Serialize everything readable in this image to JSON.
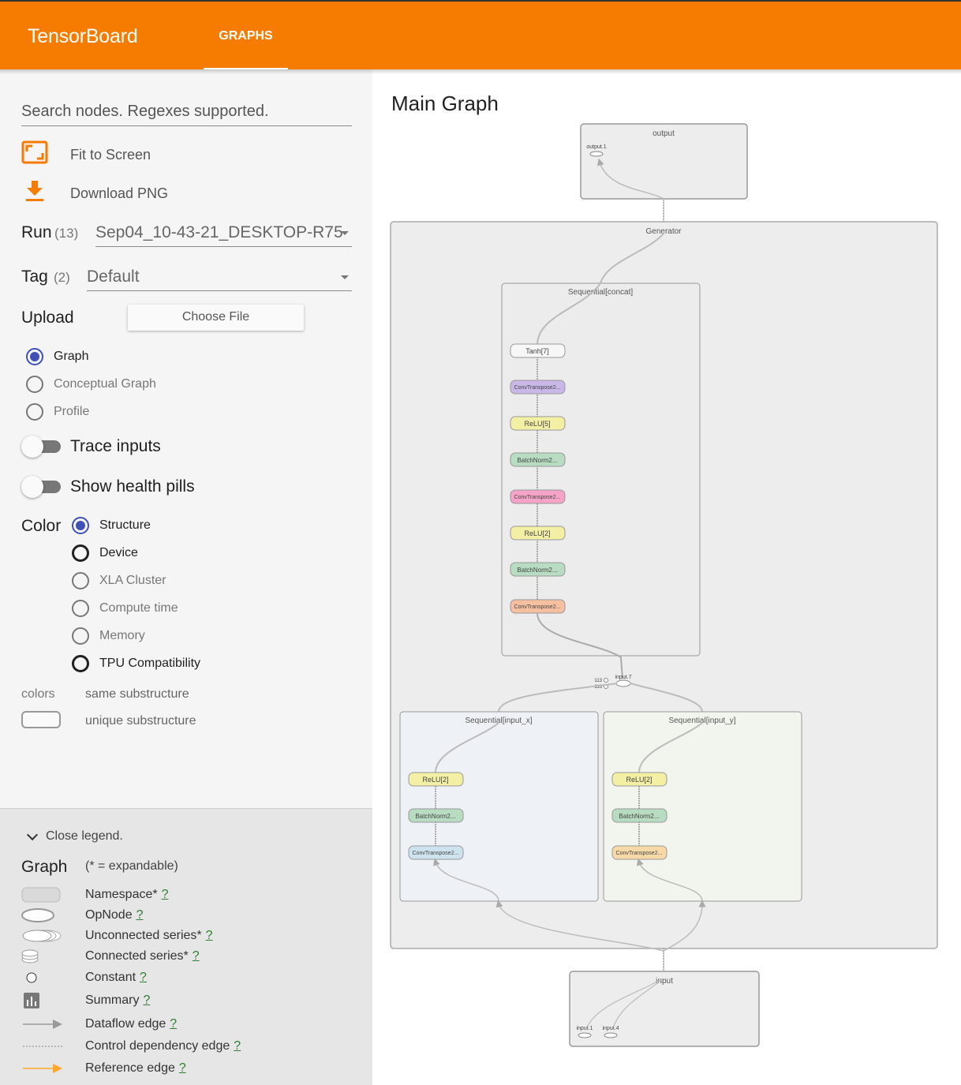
{
  "app": {
    "title": "TensorBoard",
    "tab": "GRAPHS"
  },
  "sidebar": {
    "search_placeholder": "Search nodes. Regexes supported.",
    "fit_to_screen": "Fit to Screen",
    "download_png": "Download PNG",
    "run": {
      "label": "Run",
      "count": "(13)",
      "value": "Sep04_10-43-21_DESKTOP-R75"
    },
    "tag": {
      "label": "Tag",
      "count": "(2)",
      "value": "Default"
    },
    "upload": {
      "label": "Upload",
      "button": "Choose File"
    },
    "graph_type": [
      {
        "label": "Graph",
        "checked": true
      },
      {
        "label": "Conceptual Graph",
        "checked": false
      },
      {
        "label": "Profile",
        "checked": false
      }
    ],
    "trace_inputs": "Trace inputs",
    "show_health_pills": "Show health pills",
    "color": {
      "label": "Color",
      "options": [
        {
          "label": "Structure",
          "checked": true
        },
        {
          "label": "Device",
          "checked": false
        },
        {
          "label": "XLA Cluster",
          "checked": false
        },
        {
          "label": "Compute time",
          "checked": false
        },
        {
          "label": "Memory",
          "checked": false
        },
        {
          "label": "TPU Compatibility",
          "checked": false
        }
      ]
    },
    "colors_label": "colors",
    "same_substructure": "same substructure",
    "unique_substructure": "unique substructure"
  },
  "legend": {
    "close": "Close legend.",
    "title": "Graph",
    "subtitle": "(* = expandable)",
    "items": [
      {
        "label": "Namespace*",
        "help": "?"
      },
      {
        "label": "OpNode",
        "help": "?"
      },
      {
        "label": "Unconnected series*",
        "help": "?"
      },
      {
        "label": "Connected series*",
        "help": "?"
      },
      {
        "label": "Constant",
        "help": "?"
      },
      {
        "label": "Summary",
        "help": "?"
      },
      {
        "label": "Dataflow edge",
        "help": "?"
      },
      {
        "label": "Control dependency edge",
        "help": "?"
      },
      {
        "label": "Reference edge",
        "help": "?"
      }
    ]
  },
  "graph": {
    "title": "Main Graph",
    "output": {
      "name": "output",
      "child": "output.1"
    },
    "generator": "Generator",
    "concat": {
      "name": "Sequential[concat]",
      "nodes": [
        "Tanh[7]",
        "ConvTranspose2...",
        "ReLU[5]",
        "BatchNorm2...",
        "ConvTranspose2...",
        "ReLU[2]",
        "BatchNorm2...",
        "ConvTranspose2..."
      ]
    },
    "join": {
      "name": "input.7",
      "inputs": [
        "113",
        "116"
      ]
    },
    "input_x": {
      "name": "Sequential[input_x]",
      "nodes": [
        "ReLU[2]",
        "BatchNorm2...",
        "ConvTranspose2..."
      ]
    },
    "input_y": {
      "name": "Sequential[input_y]",
      "nodes": [
        "ReLU[2]",
        "BatchNorm2...",
        "ConvTranspose2..."
      ]
    },
    "input": {
      "name": "input",
      "children": [
        "input.1",
        "input.4"
      ]
    }
  },
  "colors": {
    "header": "#f57c00",
    "radio_checked": "#3f51b5",
    "help_link": "#2e7d32",
    "reference_edge": "#ffb74d",
    "relu": "#f3f0a5",
    "batchnorm": "#b7dcc1",
    "conv_purple": "#c9b7e8",
    "conv_pink": "#f5a3c7",
    "conv_orange": "#f6bfa0",
    "conv_blue": "#cde3ee",
    "conv_tan": "#f7d9a8",
    "input_x_bg": "#eef1f6",
    "input_y_bg": "#f1f5ed"
  },
  "icons": [
    "fit-screen-icon",
    "download-icon",
    "chevron-down-icon",
    "summary-icon",
    "arrow-icon"
  ]
}
